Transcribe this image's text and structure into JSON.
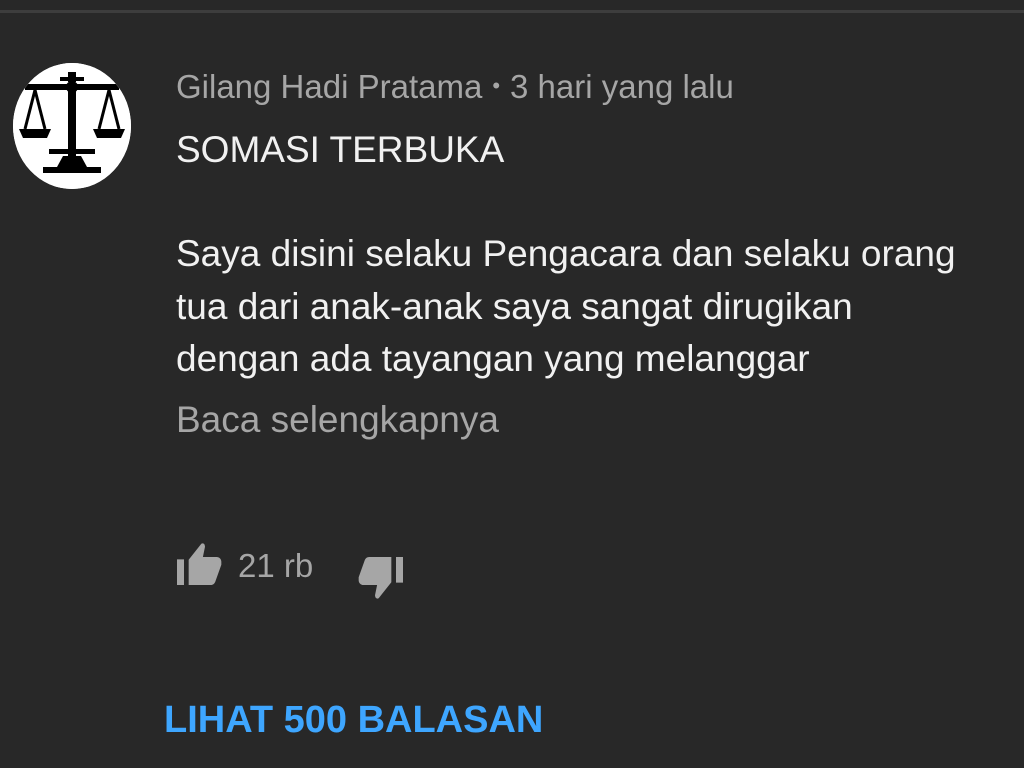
{
  "comment": {
    "author": "Gilang Hadi Pratama",
    "separator": "•",
    "timestamp": "3 hari yang lalu",
    "avatar_icon": "scales-of-justice-icon",
    "title": "SOMASI TERBUKA",
    "body_lines": [
      "Saya disini selaku Pengacara dan selaku orang",
      "tua dari anak-anak saya sangat dirugikan",
      "dengan ada tayangan yang melanggar"
    ],
    "read_more_label": "Baca selengkapnya",
    "like_count": "21 rb",
    "like_icon": "thumbs-up-icon",
    "dislike_icon": "thumbs-down-icon",
    "replies_label": "LIHAT 500 BALASAN"
  },
  "colors": {
    "background": "#282828",
    "primary_text": "#f1f1f1",
    "secondary_text": "#a6a6a6",
    "link_blue": "#3ea6ff"
  }
}
